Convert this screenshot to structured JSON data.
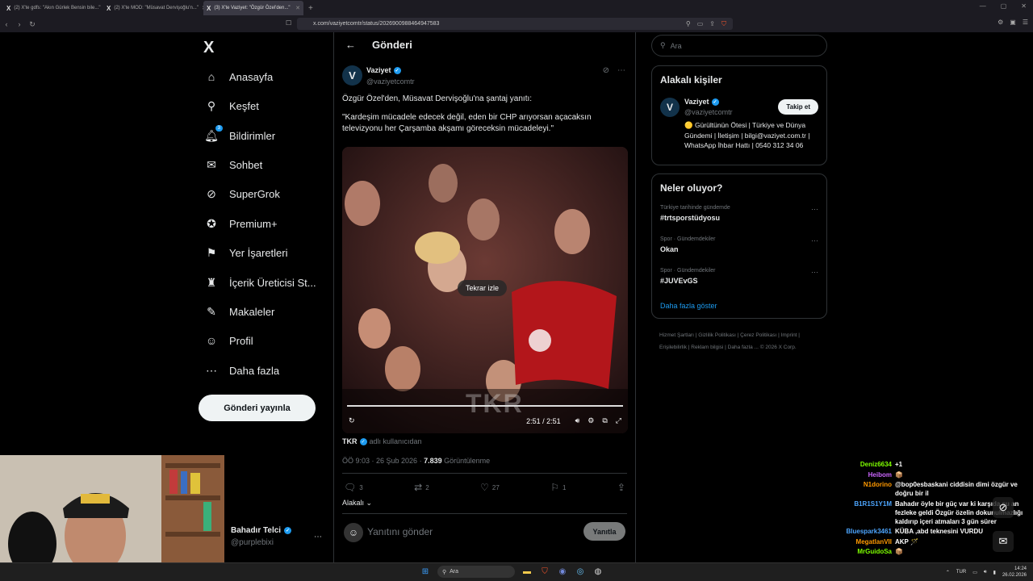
{
  "browser": {
    "tabs": [
      {
        "label": "(2) X'te gdfs: \"Akın Gürlek Bensin bile...\"",
        "active": false
      },
      {
        "label": "(2) X'te MOD: \"Müsavat Dervişoğlu'n...\"",
        "active": false
      },
      {
        "label": "(3) X'te Vaziyet: \"Özgür Özel'den...\"",
        "active": true
      }
    ],
    "url": "x.com/vaziyetcomtr/status/2026900988464947583"
  },
  "sidebar": {
    "logo": "X",
    "items": [
      {
        "label": "Anasayfa",
        "icon": "home-icon",
        "glyph": "⌂"
      },
      {
        "label": "Keşfet",
        "icon": "search-icon",
        "glyph": "⚲"
      },
      {
        "label": "Bildirimler",
        "icon": "bell-icon",
        "glyph": "♫",
        "badge": "3"
      },
      {
        "label": "Sohbet",
        "icon": "mail-icon",
        "glyph": "✉"
      },
      {
        "label": "SuperGrok",
        "icon": "grok-icon",
        "glyph": "⊘"
      },
      {
        "label": "Premium+",
        "icon": "premium-icon",
        "glyph": "✪"
      },
      {
        "label": "Yer İşaretleri",
        "icon": "bookmark-icon",
        "glyph": "⚑"
      },
      {
        "label": "İçerik Üreticisi St...",
        "icon": "creator-icon",
        "glyph": "♜"
      },
      {
        "label": "Makaleler",
        "icon": "article-icon",
        "glyph": "✎"
      },
      {
        "label": "Profil",
        "icon": "profile-icon",
        "glyph": "☺"
      },
      {
        "label": "Daha fazla",
        "icon": "more-icon",
        "glyph": "⋯"
      }
    ],
    "post_button": "Gönderi yayınla",
    "profile": {
      "name": "Bahadır Telci",
      "handle": "@purplebixi"
    }
  },
  "main": {
    "title": "Gönderi",
    "author": {
      "name": "Vaziyet",
      "handle": "@vaziyetcomtr",
      "avatar_letter": "V"
    },
    "text_line1": "Özgür Özel'den, Müsavat Dervişoğlu'na şantaj yanıtı:",
    "text_line2": "\"Kardeşim mücadele edecek değil, eden bir CHP arıyorsan açacaksın televizyonu her Çarşamba akşamı göreceksin mücadeleyi.\"",
    "video": {
      "replay_label": "Tekrar izle",
      "time": "2:51 / 2:51",
      "watermark": "TKR",
      "progress": 1.0
    },
    "source": {
      "name": "TKR",
      "label": "adlı kullanıcıdan"
    },
    "meta": {
      "timestamp": "ÖÖ 9:03 · 26 Şub 2026 · ",
      "views": "7.839",
      "views_label": " Görüntülenme"
    },
    "stats": {
      "replies": "3",
      "reposts": "2",
      "likes": "27",
      "bookmarks": "1"
    },
    "sort_label": "Alakalı",
    "reply_placeholder": "Yanıtını gönder",
    "reply_button": "Yanıtla"
  },
  "right": {
    "search_placeholder": "Ara",
    "related": {
      "title": "Alakalı kişiler",
      "name": "Vaziyet",
      "handle": "@vaziyetcomtr",
      "follow": "Takip et",
      "bio": "🟡 Gürültünün Ötesi | Türkiye ve Dünya Gündemi | İletişim | bilgi@vaziyet.com.tr | WhatsApp İhbar Hattı | 0540 312 34 06"
    },
    "trends": {
      "title": "Neler oluyor?",
      "items": [
        {
          "context": "Türkiye tarihinde gündemde",
          "name": "#trtsporstüdyosu"
        },
        {
          "context": "Spor · Gündemdekiler",
          "name": "Okan"
        },
        {
          "context": "Spor · Gündemdekiler",
          "name": "#JUVEvGS"
        }
      ],
      "show_more": "Daha fazla göster"
    },
    "footer": "Hizmet Şartları | Gizlilik Politikası | Çerez Politikası | Imprint | Erişilebilirlik | Reklam bilgisi | Daha fazla ... © 2026 X Corp."
  },
  "chat": [
    {
      "user": "Deniz6634",
      "color": "#7fff00",
      "msg": "+1"
    },
    {
      "user": "Heibom",
      "color": "#cc66ff",
      "msg": "📦"
    },
    {
      "user": "N1dorino",
      "color": "#ff9900",
      "msg": "@bop0esbaskani ciddisin dimi özgür ve doğru bir il"
    },
    {
      "user": "B1R1S1Y1M",
      "color": "#4da6ff",
      "msg": "Bahadır öyle bir güç var ki karşıda şu an fezleke geldi Özgür özelin dokunulmazlığı kaldırıp içeri atmaları 3 gün sürer"
    },
    {
      "user": "Bluespark3461",
      "color": "#4da6ff",
      "msg": "KÜBA ,abd teknesini VURDU"
    },
    {
      "user": "MegatlanVII",
      "color": "#ff9900",
      "msg": "AKP 🪄"
    },
    {
      "user": "MrGuidoSa",
      "color": "#7fff00",
      "msg": "📦"
    }
  ],
  "taskbar": {
    "search": "Ara",
    "lang": "TUR",
    "time": "14:24",
    "date": "26.02.2026"
  }
}
